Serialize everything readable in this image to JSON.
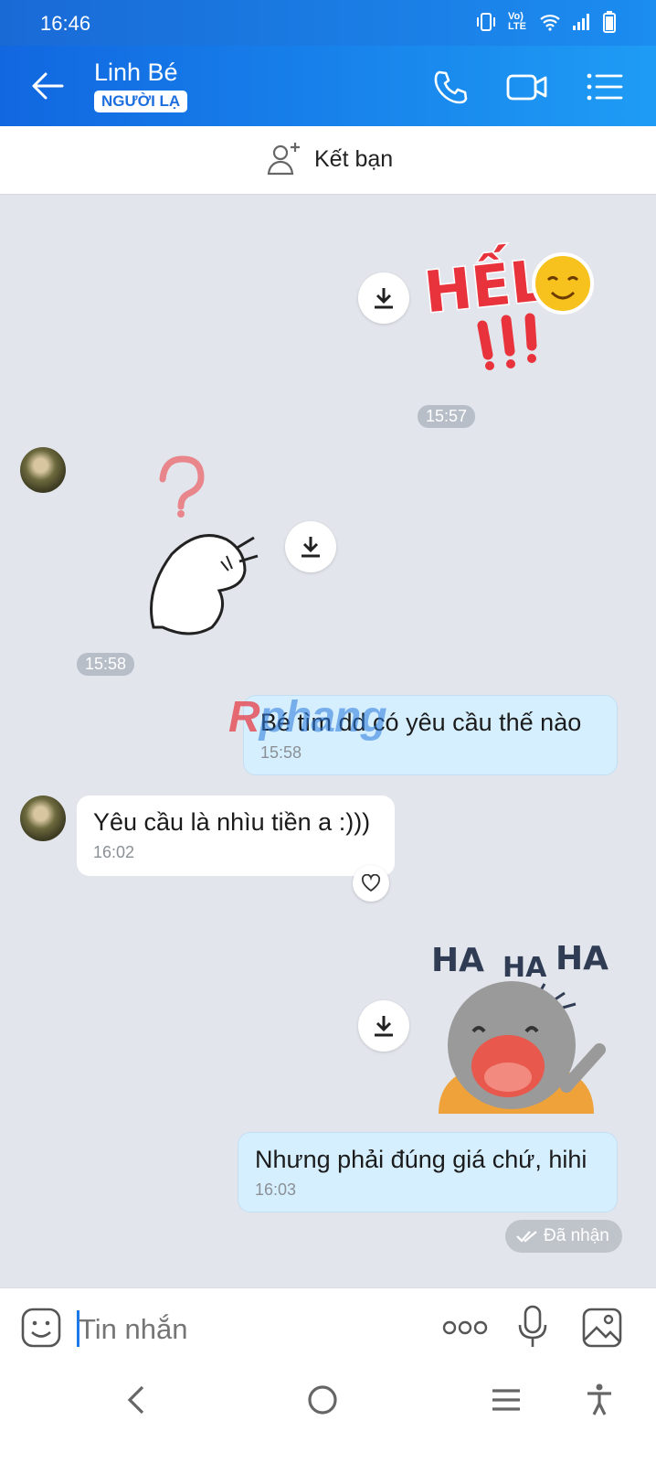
{
  "status_bar": {
    "time": "16:46",
    "network_label": "Vo) LTE"
  },
  "header": {
    "contact_name": "Linh Bé",
    "badge": "NGƯỜI LẠ"
  },
  "friend_bar": {
    "label": "Kết bạn"
  },
  "sticker_hello": {
    "text": "HẾL"
  },
  "sticker_haha": {
    "text_1": "HA",
    "text_2": "HA",
    "text_3": "HA"
  },
  "timestamps": {
    "t1": "15:57",
    "t2": "15:58"
  },
  "messages": [
    {
      "text": "Bé tìm dd có yêu cầu thế nào",
      "time": "15:58"
    },
    {
      "text": "Yêu cầu là nhìu tiền a :)))",
      "time": "16:02"
    },
    {
      "text": "Nhưng phải đúng giá chứ, hihi",
      "time": "16:03"
    }
  ],
  "receipt": {
    "label": "Đã nhận"
  },
  "watermark": {
    "part1": "R",
    "part2": "phang"
  },
  "input": {
    "placeholder": "Tin nhắn"
  },
  "colors": {
    "header_start": "#1167e0",
    "header_end": "#1e9cf5",
    "outgoing_bubble": "#d6efff",
    "chat_bg": "#e2e6ec"
  }
}
